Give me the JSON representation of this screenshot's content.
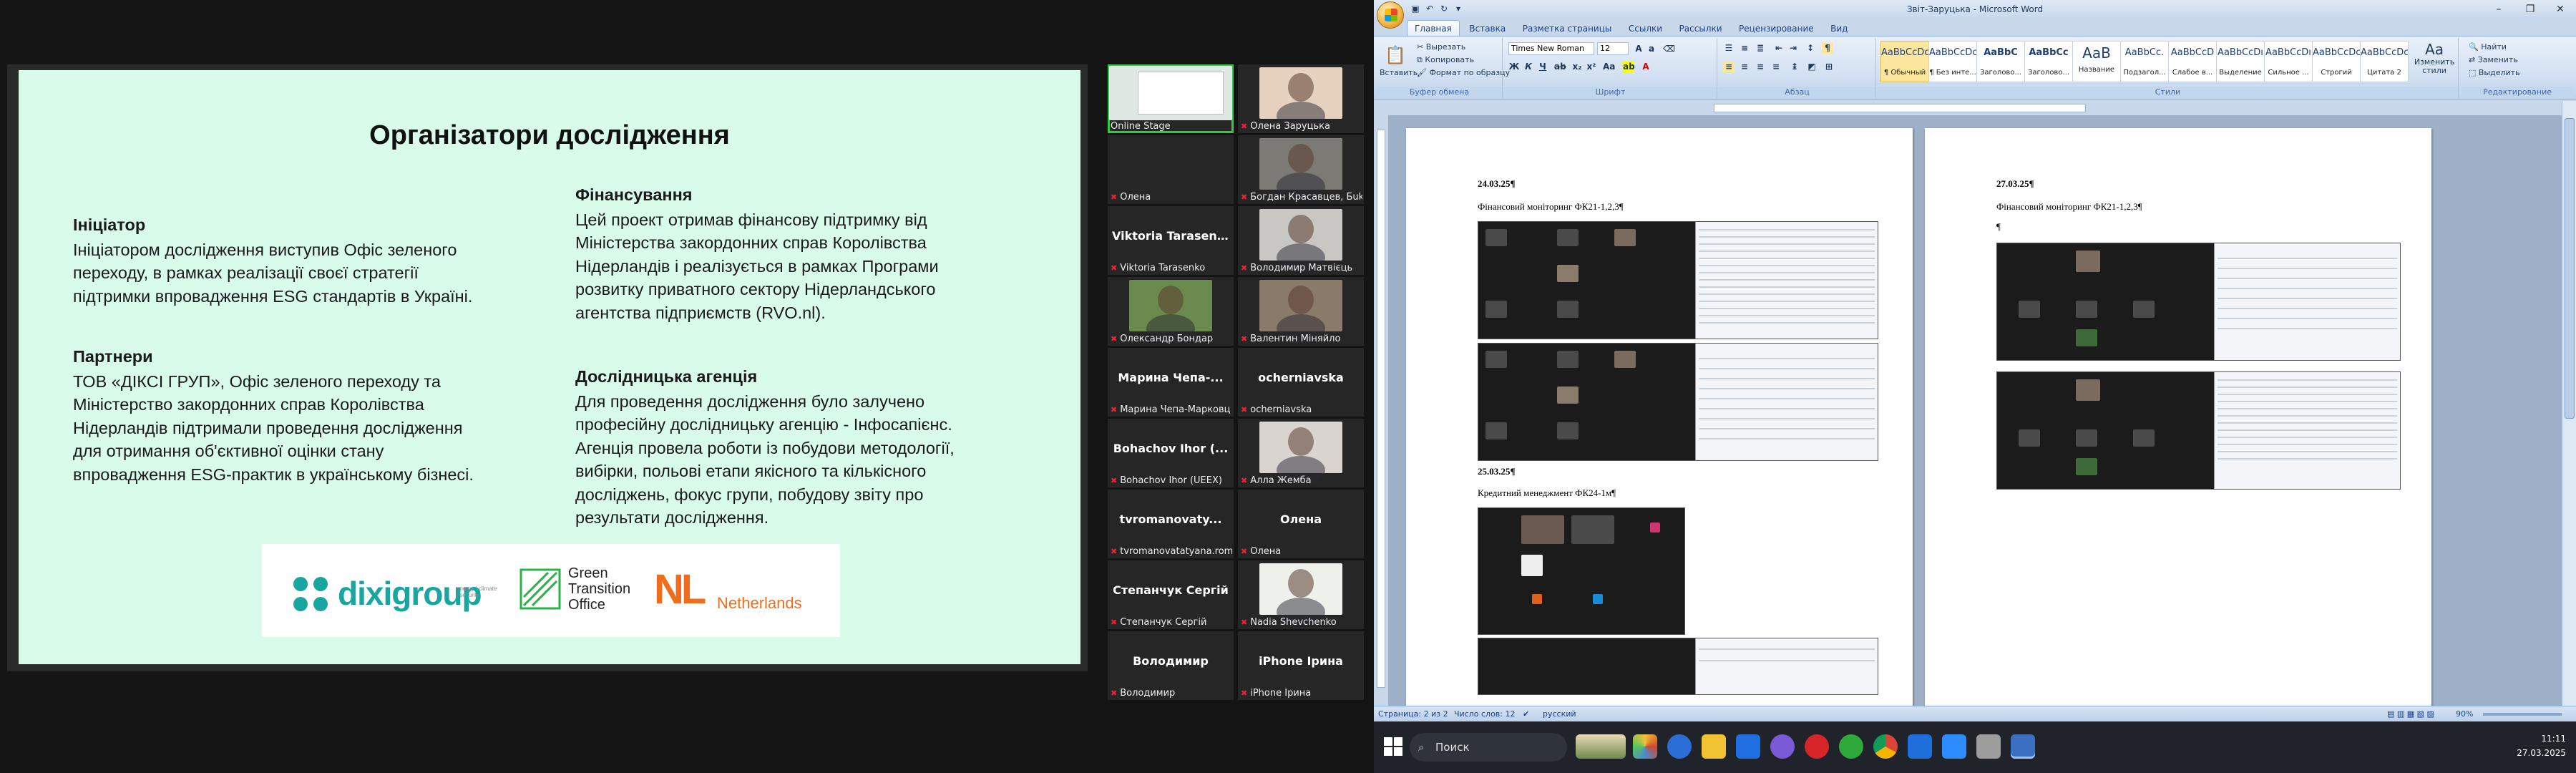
{
  "zoom": {
    "slide": {
      "title": "Організатори дослідження",
      "initiator_head": "Ініціатор",
      "initiator_text": [
        "Ініціатором дослідження виступив Офіс зеленого",
        "переходу, в рамках реалізації своєї стратегії",
        "підтримки впровадження ESG стандартів в Україні."
      ],
      "partners_head": "Партнери",
      "partners_text": [
        "ТОВ «ДІКСІ ГРУП», Офіс зеленого переходу та",
        "Міністерство закордонних справ Королівства",
        "Нідерландів підтримали проведення дослідження",
        "для отримання об'єктивної оцінки стану",
        "впровадження  ESG-практик в українському бізнесі."
      ],
      "finance_head": "Фінансування",
      "finance_text": [
        "Цей проект отримав фінансову підтримку від",
        "Міністерства закордонних справ Королівства",
        "Нідерландів і реалізується в рамках Програми",
        "розвитку приватного сектору Нідерландського",
        "агентства підприємств (RVO.nl)."
      ],
      "agency_head": "Дослідницька агенція",
      "agency_text": [
        "Для проведення дослідження було залучено",
        "професійну дослідницьку агенцію - Інфосапієнс.",
        "Агенція провела роботи із побудови методології,",
        "вибірки, польові етапи якісного та кількісного",
        "досліджень, фокус групи, побудову звіту про",
        "результати дослідження."
      ],
      "logo_dixi": "dixigroup",
      "logo_dixi_sub": "energy | climate | security",
      "logo_gto": [
        "Green",
        "Transition",
        "Office"
      ],
      "logo_nl_mark": "NL",
      "logo_nl_text": "Netherlands"
    },
    "participants": [
      {
        "label": "Online Stage",
        "big": "",
        "video": true,
        "active": true,
        "tint": "#dfe8e2"
      },
      {
        "label": "Олена Заруцька",
        "big": "",
        "video": true,
        "tint": "#e7d2c0"
      },
      {
        "label": "Олена",
        "big": "",
        "video": false
      },
      {
        "label": "Богдан Красавцев, Бuk...",
        "big": "",
        "video": true,
        "tint": "#7b7a74"
      },
      {
        "label": "Viktoria Tarasenko",
        "big": "Viktoria Tarasen...",
        "video": false
      },
      {
        "label": "Володимир Матвієць",
        "big": "",
        "video": true,
        "tint": "#c9c7c4"
      },
      {
        "label": "Олександр Бондар",
        "big": "",
        "video": true,
        "tint": "#6b8a4e"
      },
      {
        "label": "Валентин Міняйло",
        "big": "",
        "video": true,
        "tint": "#8a7a6a"
      },
      {
        "label": "Марина Чепа-Марковц",
        "big": "Марина  Чепа-...",
        "video": false
      },
      {
        "label": "ocherniavska",
        "big": "ocherniavska",
        "video": false
      },
      {
        "label": "Bohachov Ihor (UEEX)",
        "big": "Bohachov Ihor (...",
        "video": false
      },
      {
        "label": "Алла Жемба",
        "big": "",
        "video": true,
        "tint": "#d9d4d0"
      },
      {
        "label": "tvromanovatatyana.rom...",
        "big": "tvromanovaty...",
        "video": false
      },
      {
        "label": "Олена",
        "big": "Олена",
        "video": false
      },
      {
        "label": "Степанчук Сергій",
        "big": "Степанчук Сергій",
        "video": false
      },
      {
        "label": "Nadia Shevchenko",
        "big": "",
        "video": true,
        "tint": "#eef0ec"
      },
      {
        "label": "Володимир",
        "big": "Володимир",
        "video": false
      },
      {
        "label": "iPhone Ірина",
        "big": "iPhone Ірина",
        "video": false
      }
    ]
  },
  "word": {
    "title": "Звіт-Заруцька - Microsoft Word",
    "tabs": [
      "Главная",
      "Вставка",
      "Разметка страницы",
      "Ссылки",
      "Рассылки",
      "Рецензирование",
      "Вид"
    ],
    "clipboard": {
      "paste": "Вставить",
      "cut": "Вырезать",
      "copy": "Копировать",
      "format": "Формат по образцу",
      "label": "Буфер обмена"
    },
    "font": {
      "name": "Times New Roman",
      "size": "12",
      "label": "Шрифт"
    },
    "paragraph_label": "Абзац",
    "styles": [
      {
        "preview": "AaBbCcDc",
        "name": "¶ Обычный",
        "selected": true
      },
      {
        "preview": "AaBbCcDc",
        "name": "¶ Без инте..."
      },
      {
        "preview": "AaBbC",
        "name": "Заголово..."
      },
      {
        "preview": "AaBbCc",
        "name": "Заголово..."
      },
      {
        "preview": "AaB",
        "name": "Название"
      },
      {
        "preview": "AaBbCc.",
        "name": "Подзагол..."
      },
      {
        "preview": "AaBbCcD",
        "name": "Слабое в..."
      },
      {
        "preview": "AaBbCcDı",
        "name": "Выделение"
      },
      {
        "preview": "AaBbCcDı",
        "name": "Сильное ..."
      },
      {
        "preview": "AaBbCcDc",
        "name": "Строгий"
      },
      {
        "preview": "AaBbCcDc",
        "name": "Цитата 2"
      }
    ],
    "styles_label": "Стили",
    "change_styles": "Изменить стили",
    "editing": {
      "find": "Найти",
      "replace": "Заменить",
      "select": "Выделить",
      "label": "Редактирование"
    },
    "page1": {
      "date1": "24.03.25¶",
      "line1": "Фінансовий моніторинг ФК21-1,2,3¶",
      "date2": "25.03.25¶",
      "line2": "Кредитний менеджмент ФК24-1м¶"
    },
    "page2": {
      "date1": "27.03.25¶",
      "line1": "Фінансовий моніторинг ФК21-1,2,3¶",
      "mark": "¶"
    },
    "status": {
      "page": "Страница: 2 из 2",
      "words": "Число слов: 12",
      "lang": "русский",
      "zoom": "90%"
    },
    "taskbar": {
      "search": "Поиск",
      "time": "11:11",
      "date": "27.03.2025"
    }
  }
}
